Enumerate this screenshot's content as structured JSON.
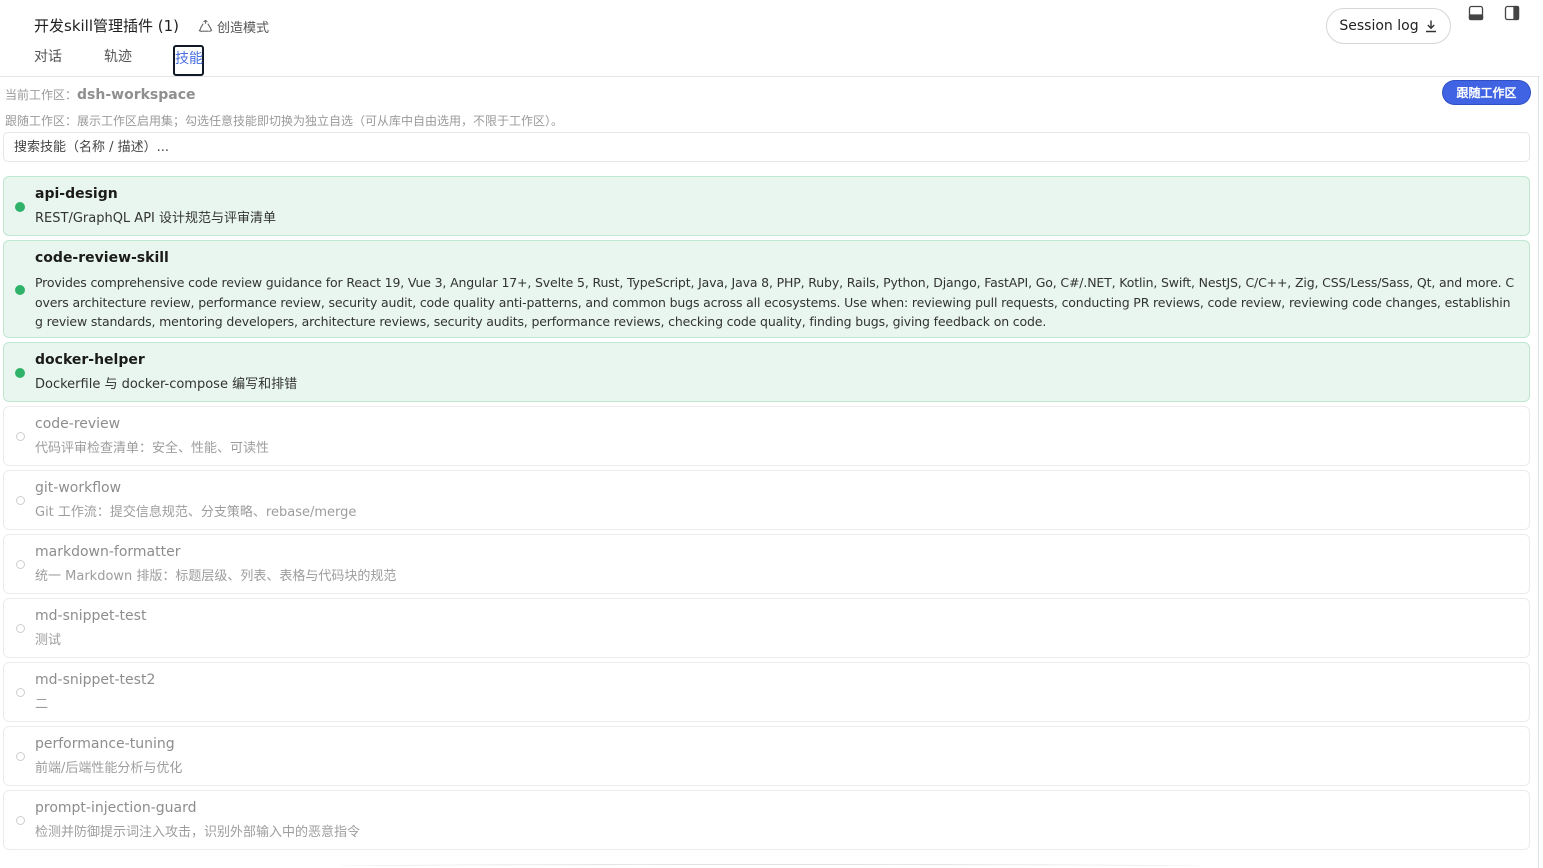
{
  "header": {
    "title": "开发skill管理插件 (1)",
    "mode_label": "创造模式",
    "session_log_label": "Session log"
  },
  "tabs": [
    {
      "label": "对话",
      "active": false
    },
    {
      "label": "轨迹",
      "active": false
    },
    {
      "label": "技能",
      "active": true
    }
  ],
  "workspace": {
    "prefix": "当前工作区：",
    "name": "dsh-workspace",
    "follow_button": "跟随工作区",
    "hint": "跟随工作区：展示工作区启用集；勾选任意技能即切换为独立自选（可从库中自由选用，不限于工作区）。"
  },
  "search": {
    "placeholder": "搜索技能（名称 / 描述）..."
  },
  "skills": [
    {
      "name": "api-design",
      "desc": "REST/GraphQL API 设计规范与评审清单",
      "enabled": true
    },
    {
      "name": "code-review-skill",
      "desc": "Provides comprehensive code review guidance for React 19, Vue 3, Angular 17+, Svelte 5, Rust, TypeScript, Java, Java 8, PHP, Ruby, Rails, Python, Django, FastAPI, Go, C#/.NET, Kotlin, Swift, NestJS, C/C++, Zig, CSS/Less/Sass, Qt, and more. Covers architecture review, performance review, security audit, code quality anti-patterns, and common bugs across all ecosystems. Use when: reviewing pull requests, conducting PR reviews, code review, reviewing code changes, establishing review standards, mentoring developers, architecture reviews, security audits, performance reviews, checking code quality, finding bugs, giving feedback on code.",
      "enabled": true
    },
    {
      "name": "docker-helper",
      "desc": "Dockerfile 与 docker-compose 编写和排错",
      "enabled": true
    },
    {
      "name": "code-review",
      "desc": "代码评审检查清单：安全、性能、可读性",
      "enabled": false
    },
    {
      "name": "git-workflow",
      "desc": "Git 工作流：提交信息规范、分支策略、rebase/merge",
      "enabled": false
    },
    {
      "name": "markdown-formatter",
      "desc": "统一 Markdown 排版：标题层级、列表、表格与代码块的规范",
      "enabled": false
    },
    {
      "name": "md-snippet-test",
      "desc": "测试",
      "enabled": false
    },
    {
      "name": "md-snippet-test2",
      "desc": "二",
      "enabled": false
    },
    {
      "name": "performance-tuning",
      "desc": "前端/后端性能分析与优化",
      "enabled": false
    },
    {
      "name": "prompt-injection-guard",
      "desc": "检测并防御提示词注入攻击，识别外部输入中的恶意指令",
      "enabled": false
    }
  ]
}
